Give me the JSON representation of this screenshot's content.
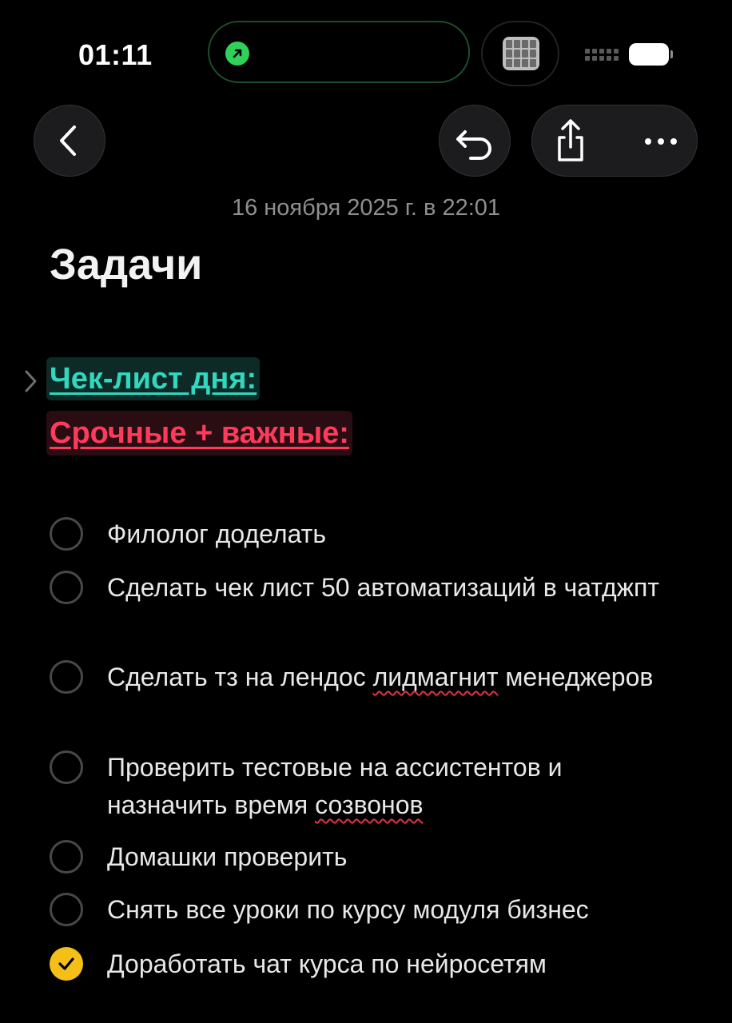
{
  "status_bar": {
    "time": "01:11"
  },
  "note": {
    "date": "16 ноября 2025 г. в 22:01",
    "title": "Задачи",
    "heading_teal": "Чек-лист дня:",
    "heading_red": "Срочные + важные:"
  },
  "tasks": [
    {
      "text": "Филолог доделать",
      "done": false
    },
    {
      "text_before": "Сделать чек лист 50 автоматизаций в чатджпт",
      "done": false
    },
    {
      "text_before": "Сделать тз на лендос ",
      "text_misspelled": "лидмагнит",
      "text_after": " менеджеров",
      "done": false
    },
    {
      "text_before": "Проверить тестовые на ассистентов и назначить время ",
      "text_misspelled": "созвонов",
      "done": false
    },
    {
      "text": "Домашки проверить",
      "done": false
    },
    {
      "text": "Снять все уроки по курсу модуля бизнес",
      "done": false
    },
    {
      "text": "Доработать чат курса по нейросетям",
      "done": true
    }
  ],
  "colors": {
    "teal_heading": "#2fd8bf",
    "red_heading": "#ff3b5c",
    "checkbox_done": "#f4c018",
    "island_active": "#30d158"
  },
  "icons": [
    "arrow-up-right-icon",
    "chevron-left-icon",
    "undo-icon",
    "share-icon",
    "more-icon",
    "disclosure-chevron-icon",
    "checkmark-icon"
  ]
}
